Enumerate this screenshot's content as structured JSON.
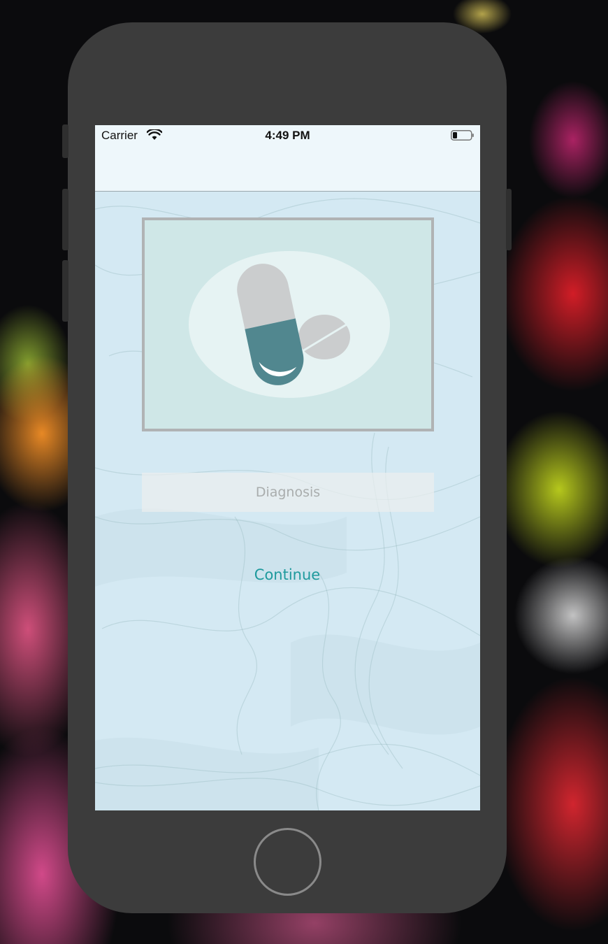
{
  "status_bar": {
    "carrier": "Carrier",
    "time": "4:49 PM",
    "wifi_icon": "wifi-icon",
    "battery_icon": "battery-icon"
  },
  "main": {
    "logo_icon": "pill-capsule-icon",
    "diagnosis_placeholder": "Diagnosis",
    "diagnosis_value": "",
    "continue_label": "Continue"
  },
  "colors": {
    "accent": "#1e9a9d",
    "capsule_teal": "#51878f",
    "logo_bg": "#cfe7e7",
    "screen_bg": "#d4e9f3"
  }
}
